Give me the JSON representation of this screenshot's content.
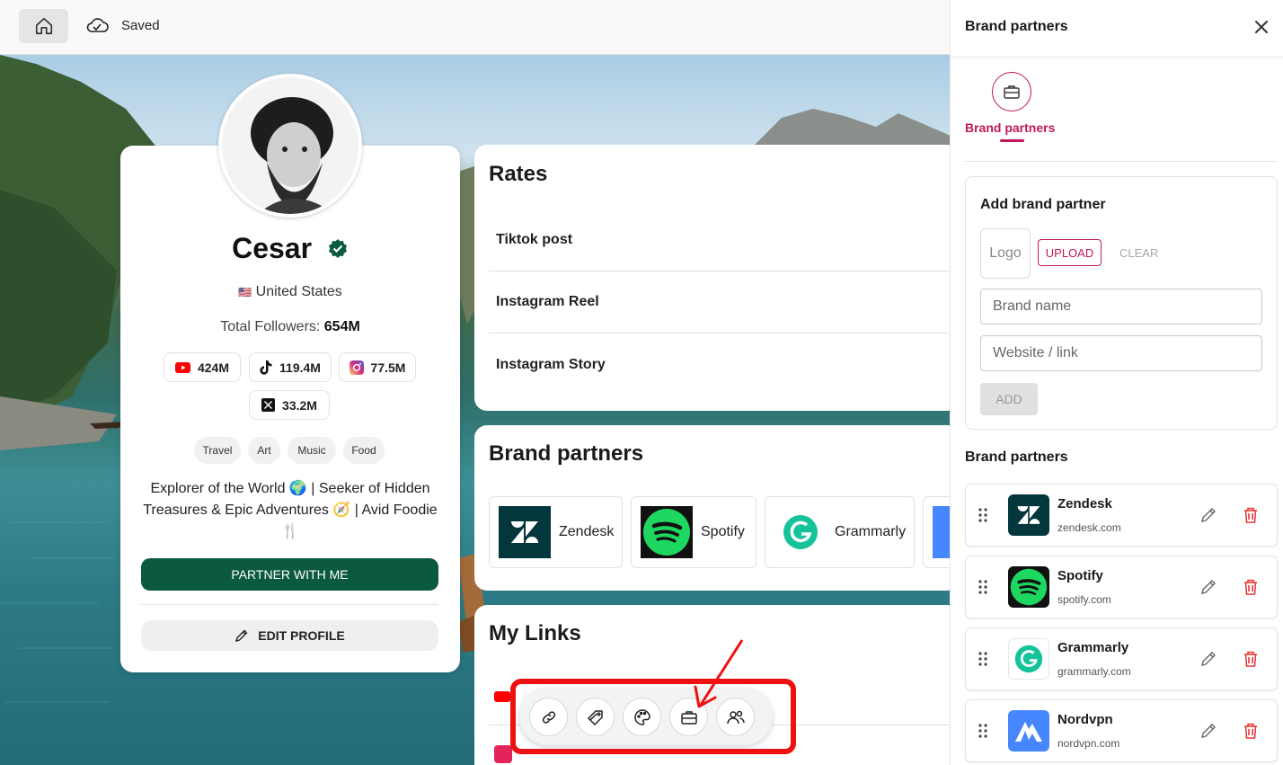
{
  "topbar": {
    "saved_label": "Saved"
  },
  "profile": {
    "name": "Cesar",
    "country_flag": "🇺🇸",
    "country": "United States",
    "followers_label": "Total Followers: ",
    "followers_value": "654M",
    "socials": [
      {
        "platform": "youtube",
        "count": "424M"
      },
      {
        "platform": "tiktok",
        "count": "119.4M"
      },
      {
        "platform": "instagram",
        "count": "77.5M"
      },
      {
        "platform": "x",
        "count": "33.2M"
      }
    ],
    "tags": [
      "Travel",
      "Art",
      "Music",
      "Food"
    ],
    "bio": "Explorer of the World 🌍 | Seeker of Hidden Treasures & Epic Adventures 🧭 | Avid Foodie 🍴",
    "partner_button": "PARTNER WITH ME",
    "edit_button": "EDIT PROFILE"
  },
  "rates": {
    "title": "Rates",
    "items": [
      "Tiktok post",
      "Instagram Reel",
      "Instagram Story"
    ]
  },
  "brands_section": {
    "title": "Brand partners",
    "tiles": [
      "Zendesk",
      "Spotify",
      "Grammarly"
    ]
  },
  "links_section": {
    "title": "My Links"
  },
  "panel": {
    "title": "Brand partners",
    "tab_label": "Brand partners",
    "add_title": "Add brand partner",
    "logo_placeholder": "Logo",
    "upload_label": "UPLOAD",
    "clear_label": "CLEAR",
    "brand_name_placeholder": "Brand name",
    "website_placeholder": "Website / link",
    "add_label": "ADD",
    "list_title": "Brand partners",
    "partners": [
      {
        "name": "Zendesk",
        "url": "zendesk.com"
      },
      {
        "name": "Spotify",
        "url": "spotify.com"
      },
      {
        "name": "Grammarly",
        "url": "grammarly.com"
      },
      {
        "name": "Nordvpn",
        "url": "nordvpn.com"
      }
    ]
  },
  "colors": {
    "accent": "#c2185b",
    "primary_green": "#0b5a40",
    "highlight_red": "#ee1111"
  },
  "icons": [
    "home-icon",
    "cloud-icon",
    "verified-icon",
    "link-icon",
    "tag-icon",
    "palette-icon",
    "briefcase-icon",
    "users-icon",
    "close-icon",
    "pencil-icon",
    "trash-icon",
    "drag-handle-icon"
  ]
}
